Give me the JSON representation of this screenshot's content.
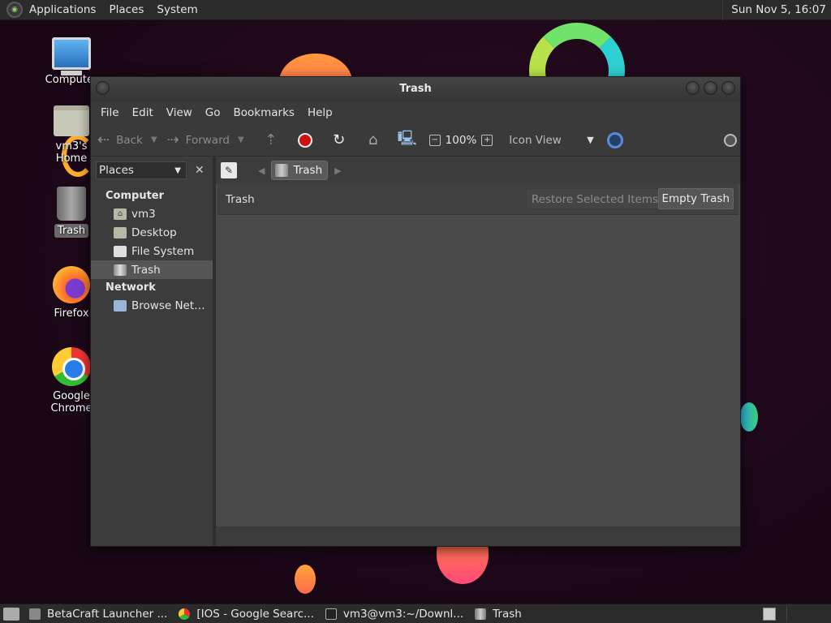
{
  "top_panel": {
    "menus": [
      "Applications",
      "Places",
      "System"
    ],
    "clock": "Sun Nov  5, 16:07"
  },
  "desktop_icons": [
    {
      "label": "Computer"
    },
    {
      "label": "vm3's Home"
    },
    {
      "label": "Trash"
    },
    {
      "label": "Firefox"
    },
    {
      "label": "Google Chrome"
    }
  ],
  "window": {
    "title": "Trash",
    "menus": [
      "File",
      "Edit",
      "View",
      "Go",
      "Bookmarks",
      "Help"
    ],
    "toolbar": {
      "back": "Back",
      "forward": "Forward",
      "zoom": "100%",
      "view_mode": "Icon View"
    },
    "sidebar": {
      "selector": "Places",
      "sections": [
        {
          "heading": "Computer",
          "items": [
            "vm3",
            "Desktop",
            "File System",
            "Trash"
          ]
        },
        {
          "heading": "Network",
          "items": [
            "Browse Net…"
          ]
        }
      ],
      "selected": "Trash"
    },
    "pathbar": {
      "crumb": "Trash"
    },
    "infobar": {
      "title": "Trash",
      "restore_label": "Restore Selected Items",
      "empty_label": "Empty Trash"
    }
  },
  "taskbar": {
    "tasks": [
      "BetaCraft Launcher ...",
      "[IOS - Google Searc...",
      "vm3@vm3:~/Downl...",
      "Trash"
    ]
  },
  "colors": {
    "window_bg": "#3c3c3c",
    "stop_red": "#d01010",
    "selected_row": "#565656"
  }
}
